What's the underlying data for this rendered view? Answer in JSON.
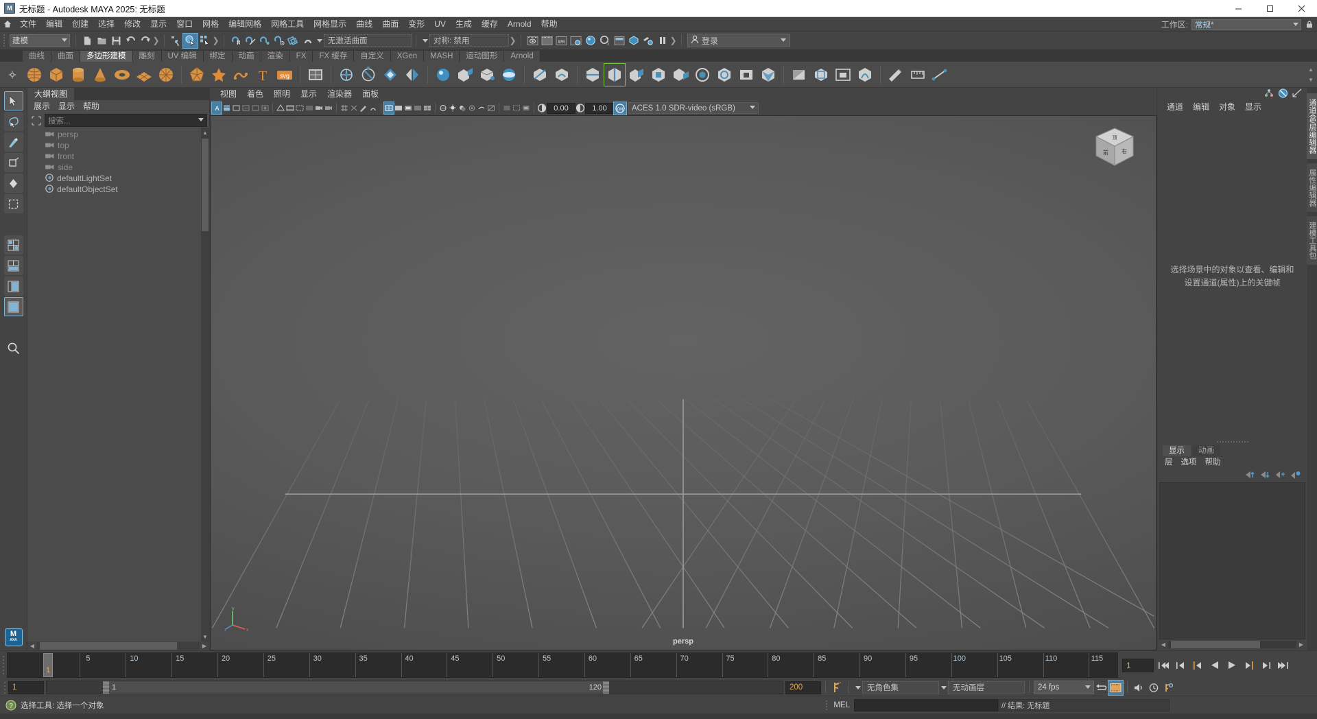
{
  "window": {
    "title": "无标题 - Autodesk MAYA 2025: 无标题",
    "app_icon": "maya-logo-icon",
    "minimize": "–",
    "maximize": "▢",
    "close": "✕"
  },
  "menubar": {
    "home_icon": "home-icon",
    "items": [
      "文件",
      "编辑",
      "创建",
      "选择",
      "修改",
      "显示",
      "窗口",
      "网格",
      "编辑网格",
      "网格工具",
      "网格显示",
      "曲线",
      "曲面",
      "变形",
      "UV",
      "生成",
      "缓存",
      "Arnold",
      "帮助"
    ],
    "workspace_label": "工作区:",
    "workspace_value": "常规*",
    "lock_icon": "lock-icon"
  },
  "statusline": {
    "mode_menu": "建模",
    "file_icons": [
      "new-scene-icon",
      "open-scene-icon",
      "save-scene-icon",
      "undo-icon",
      "redo-icon"
    ],
    "select_icons": [
      "select-hierarchy-icon",
      "select-object-icon",
      "select-component-icon"
    ],
    "snap_icons": [
      "snap-grid-icon",
      "snap-curve-icon",
      "snap-point-icon",
      "snap-projected-center-icon",
      "snap-view-plane-icon",
      "magnet-icon"
    ],
    "surface_field": "无激活曲面",
    "symmetry_field": "对称: 禁用",
    "render_icons": [
      "render-current-frame-icon",
      "render-sequence-icon",
      "ipr-icon",
      "render-settings-icon",
      "hypershade-icon",
      "render-view-icon",
      "light-editor-icon",
      "toggle-icon",
      "paint-effects-icon",
      "pause-icon"
    ],
    "login_label": "登录",
    "login_icon": "user-icon"
  },
  "shelf": {
    "tabs": [
      "曲线",
      "曲面",
      "多边形建模",
      "雕刻",
      "UV 编辑",
      "绑定",
      "动画",
      "渲染",
      "FX",
      "FX 缓存",
      "自定义",
      "XGen",
      "MASH",
      "运动图形",
      "Arnold"
    ],
    "active_tab": "多边形建模",
    "buttons": [
      "poly-sphere-icon",
      "poly-cube-icon",
      "poly-cylinder-icon",
      "poly-cone-icon",
      "poly-torus-icon",
      "poly-plane-icon",
      "poly-disc-icon",
      "poly-platonic-icon",
      "poly-type-icon",
      "poly-svg-icon",
      "poly-text-icon",
      "poly-svg2-icon",
      "poly-helix-icon",
      "combine-icon",
      "separate-icon",
      "booleans-icon",
      "mirror-icon",
      "smooth-icon",
      "extrude-icon",
      "bevel-icon",
      "bridge-icon",
      "multi-cut-icon",
      "target-weld-icon",
      "connect-icon",
      "insert-edge-loop-icon",
      "offset-edge-loop-icon",
      "quad-draw-icon",
      "append-polygon-icon",
      "fill-hole-icon",
      "circularize-icon",
      "make-hole-icon",
      "poke-icon",
      "wedge-icon",
      "chamfer-vertex-icon",
      "crease-icon",
      "soften-harden-icon",
      "sculpt-icon",
      "measure-icon",
      "distance-icon"
    ]
  },
  "toolbox": {
    "tools": [
      "select-tool-icon",
      "lasso-select-icon",
      "paint-select-icon",
      "move-tool-icon",
      "rotate-tool-icon",
      "scale-tool-icon"
    ],
    "layouts": [
      "single-pane-layout-icon",
      "four-pane-layout-icon",
      "two-pane-stacked-icon",
      "persp-outliner-layout-icon"
    ],
    "search_icon": "search-icon",
    "badge": "M",
    "badge_sub": "AXA"
  },
  "outliner": {
    "tab": "大纲视图",
    "menus": [
      "展示",
      "显示",
      "帮助"
    ],
    "search_icon": "filter-icon",
    "search_placeholder": "搜索...",
    "items": [
      {
        "label": "persp",
        "icon": "camera-icon",
        "dim": true
      },
      {
        "label": "top",
        "icon": "camera-icon",
        "dim": true
      },
      {
        "label": "front",
        "icon": "camera-icon",
        "dim": true
      },
      {
        "label": "side",
        "icon": "camera-icon",
        "dim": true
      },
      {
        "label": "defaultLightSet",
        "icon": "set-icon",
        "dim": false
      },
      {
        "label": "defaultObjectSet",
        "icon": "set-icon",
        "dim": false
      }
    ]
  },
  "viewport": {
    "menus": [
      "视图",
      "着色",
      "照明",
      "显示",
      "渲染器",
      "面板"
    ],
    "camera_label": "persp",
    "exposure_value": "0.00",
    "gamma_value": "1.00",
    "colorspace": "ACES 1.0 SDR-video (sRGB)",
    "viewcube_faces": {
      "front": "前",
      "top": "顶",
      "right": "右"
    },
    "axis": {
      "x": "x",
      "y": "y",
      "z": "z"
    },
    "icons_left": [
      "select-camera-icon",
      "bookmarks-icon",
      "image-plane-icon",
      "2d-pan-zoom-icon",
      "grease-pencil-icon",
      "isolate-select-icon",
      "xray-icon",
      "xray-joints-icon"
    ],
    "icons_mid": [
      "wireframe-icon",
      "smooth-shade-all-icon",
      "smooth-shade-selected-icon",
      "flat-shade-icon",
      "wireframe-on-shaded-icon",
      "texture-icon",
      "lighting-icon",
      "shadows-icon",
      "ao-icon",
      "motion-blur-icon",
      "aa-icon",
      "multisample-icon",
      "depth-peel-icon",
      "gamma-icon",
      "exposure-icon",
      "view-transform-icon"
    ]
  },
  "channelbox": {
    "header_icons": [
      "show-manip-icon",
      "no-entry-icon",
      "graph-icon"
    ],
    "menus": [
      "通道",
      "编辑",
      "对象",
      "显示"
    ],
    "empty_message": "选择场景中的对象以查看、编辑和设置通道(属性)上的关键帧"
  },
  "layer_editor": {
    "tabs": [
      "显示",
      "动画"
    ],
    "active_tab": "显示",
    "menus": [
      "层",
      "选项",
      "帮助"
    ],
    "icons": [
      "move-layer-up-icon",
      "move-layer-down-icon",
      "new-layer-icon",
      "new-layer-from-selected-icon"
    ]
  },
  "vertical_tabs": {
    "items": [
      "通道盒/层编辑器",
      "属性编辑器",
      "建模工具包"
    ],
    "active": "通道盒/层编辑器"
  },
  "timeslider": {
    "current_frame": "1",
    "start_label": "1",
    "ticks": [
      5,
      10,
      15,
      20,
      25,
      30,
      35,
      40,
      45,
      50,
      55,
      60,
      65,
      70,
      75,
      80,
      85,
      90,
      95,
      100,
      105,
      110,
      115,
      120
    ],
    "range_start": 1,
    "range_end": 120,
    "playback_buttons": [
      "go-to-start-icon",
      "step-back-keyframe-icon",
      "step-back-frame-icon",
      "play-backwards-icon",
      "play-forwards-icon",
      "step-forward-frame-icon",
      "step-forward-keyframe-icon",
      "go-to-end-icon"
    ],
    "frame_field": "1"
  },
  "rangeslider": {
    "anim_start": "1",
    "range_start": "1",
    "range_end": "120",
    "anim_end": "200",
    "auto_key_icon": "auto-keyframe-icon",
    "char_set": "无角色集",
    "anim_layer": "无动画层",
    "fps": "24 fps",
    "loop_icon": "loop-icon",
    "preferences_icon": "animation-preferences-icon",
    "sound_icon": "sound-icon",
    "playblast_icon": "playblast-icon",
    "anim_prefs_icon": "anim-settings-icon"
  },
  "statusbar": {
    "help_icon": "help-icon",
    "help_text": "选择工具: 选择一个对象",
    "command_label": "MEL",
    "command_value": "",
    "result_text": "// 结果: 无标题"
  },
  "colors": {
    "accent_blue": "#5285a6",
    "panel_bg": "#444444",
    "dark_field": "#2b2b2b",
    "orange": "#e0a45c",
    "highlight": "#4a7fa5"
  }
}
